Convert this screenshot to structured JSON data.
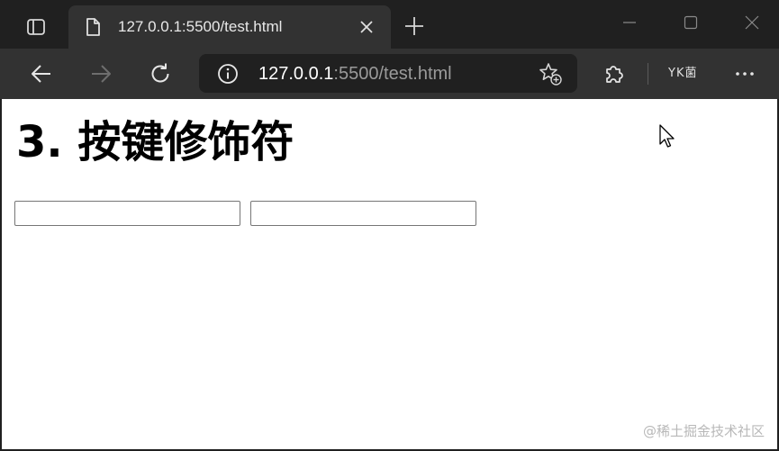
{
  "browser": {
    "tab": {
      "title": "127.0.0.1:5500/test.html"
    },
    "address_bar": {
      "host": "127.0.0.1",
      "rest": ":5500/test.html"
    },
    "profile_label": "YK菌",
    "icons": {
      "tab_actions": "tab-actions-icon",
      "favicon": "page-icon",
      "tab_close": "close-icon",
      "new_tab": "plus-icon",
      "minimize": "minimize-icon",
      "maximize": "maximize-icon",
      "window_close": "close-icon",
      "back": "arrow-left-icon",
      "forward": "arrow-right-icon",
      "refresh": "refresh-icon",
      "site_info": "info-icon",
      "favorites": "star-plus-icon",
      "extensions": "puzzle-icon",
      "more": "more-icon"
    },
    "colors": {
      "titlebar": "#202020",
      "toolbar": "#323232",
      "active_tab": "#323232",
      "address_bar": "#202020"
    }
  },
  "page": {
    "heading": "3. 按键修饰符",
    "inputs": [
      {
        "value": "",
        "placeholder": ""
      },
      {
        "value": "",
        "placeholder": ""
      }
    ]
  },
  "watermark": "@稀土掘金技术社区"
}
